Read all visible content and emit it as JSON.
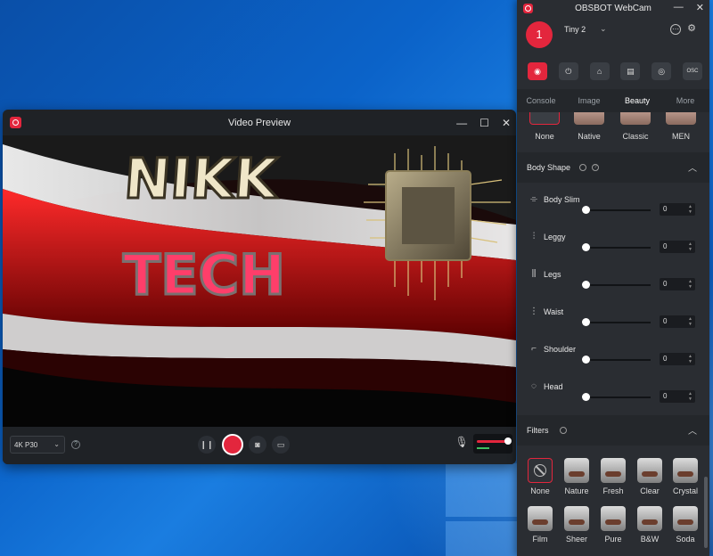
{
  "video_preview": {
    "title": "Video Preview",
    "resolution": "4K P30",
    "help": "?",
    "controls": {
      "minimize": "—",
      "maximize": "☐",
      "close": "✕"
    },
    "toolbar": {
      "pause": "❙❙",
      "snapshot": "◙",
      "folder": "▭",
      "mic": "🎙"
    },
    "video_text": {
      "line1": "NIKK",
      "line2": "TECH"
    },
    "volume": 0.93
  },
  "panel": {
    "title": "OBSBOT WebCam",
    "controls": {
      "minimize": "—",
      "close": "✕"
    },
    "device": {
      "number": "1",
      "name": "Tiny 2"
    },
    "mode_buttons": [
      {
        "icon": "camera-icon",
        "glyph": "◉"
      },
      {
        "icon": "power-icon",
        "glyph": "⏻"
      },
      {
        "icon": "tracking-icon",
        "glyph": "⌂"
      },
      {
        "icon": "screen-icon",
        "glyph": "▤"
      },
      {
        "icon": "webcam-icon",
        "glyph": "◎"
      },
      {
        "icon": "osc-icon",
        "glyph": "OSC"
      }
    ],
    "tabs": [
      "Console",
      "Image",
      "Beauty",
      "More"
    ],
    "active_tab": "Beauty",
    "styles": [
      "None",
      "Native",
      "Classic",
      "MEN"
    ],
    "body_shape": {
      "title": "Body Shape",
      "help": "?",
      "sliders": [
        {
          "label": "Body Slim",
          "value": "0",
          "glyph": "⌯"
        },
        {
          "label": "Leggy",
          "value": "0",
          "glyph": "⫶"
        },
        {
          "label": "Legs",
          "value": "0",
          "glyph": "⫼"
        },
        {
          "label": "Waist",
          "value": "0",
          "glyph": "⋮"
        },
        {
          "label": "Shoulder",
          "value": "0",
          "glyph": "⌐"
        },
        {
          "label": "Head",
          "value": "0",
          "glyph": "◌"
        }
      ]
    },
    "filters": {
      "title": "Filters",
      "items": [
        "None",
        "Nature",
        "Fresh",
        "Clear",
        "Crystal",
        "Film",
        "Sheer",
        "Pure",
        "B&W",
        "Soda"
      ]
    }
  },
  "colors": {
    "accent": "#e3263d",
    "panel_bg": "#2a2d32"
  }
}
